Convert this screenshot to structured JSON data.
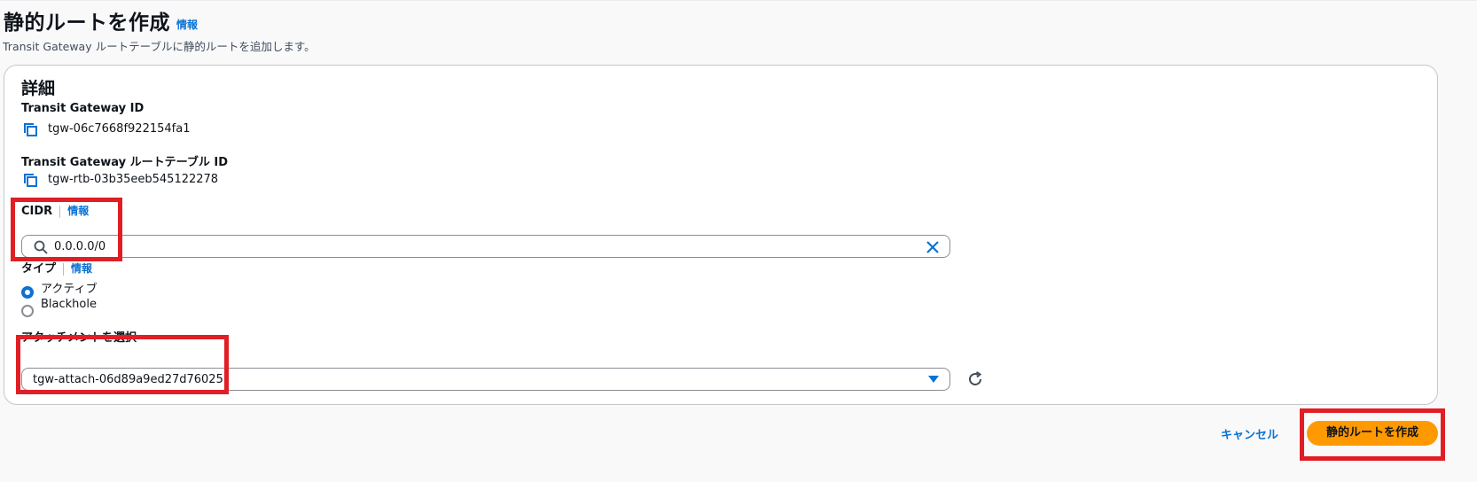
{
  "header": {
    "title": "静的ルートを作成",
    "info_link": "情報",
    "description": "Transit Gateway ルートテーブルに静的ルートを追加します。"
  },
  "details": {
    "heading": "詳細",
    "tgw_id_label": "Transit Gateway ID",
    "tgw_id_value": "tgw-06c7668f922154fa1",
    "route_table_label": "Transit Gateway ルートテーブル ID",
    "route_table_value": "tgw-rtb-03b35eeb545122278",
    "cidr_label": "CIDR",
    "cidr_info": "情報",
    "cidr_value": "0.0.0.0/0",
    "type_label": "タイプ",
    "type_info": "情報",
    "type_options": [
      {
        "label": "アクティブ",
        "checked": true
      },
      {
        "label": "Blackhole",
        "checked": false
      }
    ],
    "attachment_label": "アタッチメントを選択",
    "attachment_value": "tgw-attach-06d89a9ed27d76025"
  },
  "actions": {
    "cancel_label": "キャンセル",
    "create_label": "静的ルートを作成"
  },
  "colors": {
    "link": "#0972d3",
    "primary_button": "#ff9900",
    "highlight": "#e01e25"
  },
  "icons": [
    "copy-icon",
    "search-icon",
    "clear-icon",
    "caret-down-icon",
    "refresh-icon"
  ]
}
